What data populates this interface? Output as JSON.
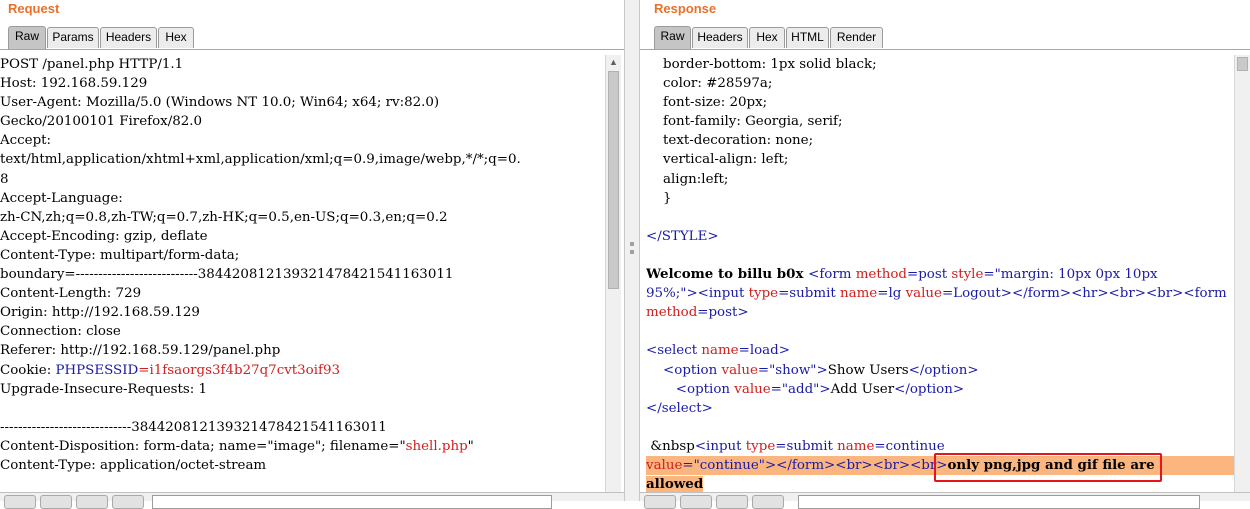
{
  "request": {
    "title": "Request",
    "tabs": [
      "Raw",
      "Params",
      "Headers",
      "Hex"
    ],
    "active_tab": "Raw",
    "lines": [
      "POST /panel.php HTTP/1.1",
      "Host: 192.168.59.129",
      "User-Agent: Mozilla/5.0 (Windows NT 10.0; Win64; x64; rv:82.0)",
      "Gecko/20100101 Firefox/82.0",
      "Accept:",
      "text/html,application/xhtml+xml,application/xml;q=0.9,image/webp,*/*;q=0.",
      "8",
      "Accept-Language:",
      "zh-CN,zh;q=0.8,zh-TW;q=0.7,zh-HK;q=0.5,en-US;q=0.3,en;q=0.2",
      "Accept-Encoding: gzip, deflate",
      "Content-Type: multipart/form-data;",
      "boundary=---------------------------384420812139321478421541163011",
      "Content-Length: 729",
      "Origin: http://192.168.59.129",
      "Connection: close",
      "Referer: http://192.168.59.129/panel.php"
    ],
    "cookie_label": "Cookie: ",
    "cookie_name": "PHPSESSID",
    "cookie_value": "=i1fsaorgs3f4b27q7cvt3oif93",
    "lines2": [
      "Upgrade-Insecure-Requests: 1",
      "",
      "-----------------------------384420812139321478421541163011"
    ],
    "disposition_prefix": "Content-Disposition: form-data; name=\"image\"; filename=\"",
    "disposition_filename": "shell.php",
    "disposition_suffix": "\"",
    "content_type_line": "Content-Type: application/octet-stream"
  },
  "response": {
    "title": "Response",
    "tabs": [
      "Raw",
      "Headers",
      "Hex",
      "HTML",
      "Render"
    ],
    "active_tab": "Raw",
    "css_lines": [
      "    border-bottom: 1px solid black;",
      "    color: #28597a;",
      "    font-size: 20px;",
      "    font-family: Georgia, serif;",
      "    text-decoration: none;",
      "    vertical-align: left;",
      "    align:left;",
      "    }"
    ],
    "style_close": "</STYLE>",
    "welcome_text": "Welcome to billu b0x ",
    "t_form_open": "<form ",
    "a_method": "method",
    "v_post": "=post ",
    "a_style": "style",
    "v_style_1": "=\"margin: 10px 0px 10px",
    "v_style_2": "95%;\"",
    "t_gt_input": "><input ",
    "a_type": "type",
    "v_submit": "=submit ",
    "a_name": "name",
    "v_lg": "=lg ",
    "a_value": "value",
    "v_logout": "=Logout",
    "t_close_hr": "></form><hr><br><br><form",
    "v_post2": "=post>",
    "t_select": "<select ",
    "v_load": "=load>",
    "t_option": "<option ",
    "v_show": "=\"show\"",
    "show_text": "Show Users",
    "t_option_close": "</option>",
    "v_add": "=\"add\"",
    "add_text": "Add User",
    "t_select_close": "</select>",
    "nbsp_text": "&nbsp",
    "t_input": "<input ",
    "v_continue_name": "=continue",
    "v_continue_val": "=\"continue\"",
    "t_tail": "></form><br><br><br>",
    "message_1": "only png,jpg and gif file",
    "message_2": " are",
    "message_3": "allowed"
  }
}
